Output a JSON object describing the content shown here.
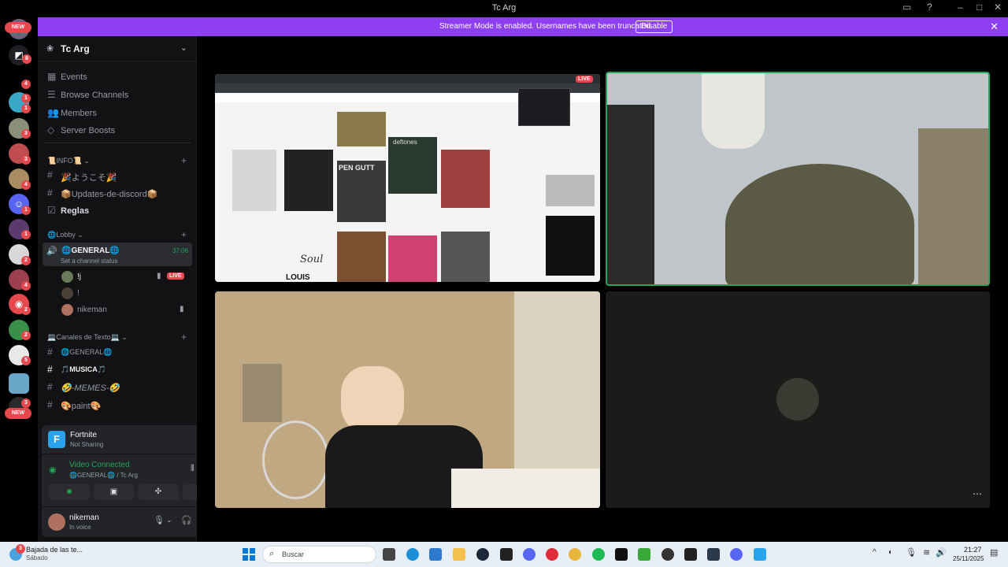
{
  "window": {
    "title": "Tc Arg"
  },
  "banner": {
    "message": "Streamer Mode is enabled. Usernames have been truncated.",
    "disable_label": "Disable"
  },
  "rail": {
    "new_top": "NEW",
    "new_bottom": "NEW",
    "badges": [
      "8",
      "4",
      "1",
      "1",
      "3",
      "3",
      "4",
      "1",
      "1",
      "2",
      "4",
      "2",
      "2",
      "5",
      "3"
    ]
  },
  "guild": {
    "name": "Tc Arg"
  },
  "nav": {
    "events": "Events",
    "browse": "Browse Channels",
    "members": "Members",
    "boosts": "Server Boosts"
  },
  "categories": {
    "info": "📜INFO📜",
    "lobby": "🌐Lobby",
    "text": "💻Canales de Texto💻"
  },
  "info_channels": [
    "🎉ようこそ🎉",
    "📦Updates-de-discord📦",
    "Reglas"
  ],
  "voice": {
    "name": "🌐GENERAL🌐",
    "timer": "37:06",
    "status": "Set a channel status",
    "users": [
      {
        "name": "!j",
        "live": "LIVE"
      },
      {
        "name": "!"
      },
      {
        "name": "nikeman"
      }
    ]
  },
  "text_channels": [
    "🌐GENERAL🌐",
    "🎵MUSICA🎵",
    "🤣-MEMES-🤣",
    "🎨paint🎨"
  ],
  "activity": {
    "game": "Fortnite",
    "status": "Not Sharing"
  },
  "connection": {
    "status": "Video Connected",
    "location": "🌐GENERAL🌐 / Tc Arg"
  },
  "user": {
    "name": "nikeman",
    "status": "In voice"
  },
  "stream": {
    "live": "LIVE"
  },
  "stream_text": {
    "band_logo": "deftones",
    "headline": "PEN GUTT",
    "script": "Soul",
    "logo": "LOUIS"
  },
  "taskbar": {
    "news_title": "Bajada de las te...",
    "news_sub": "Sábado",
    "news_badge": "3",
    "search": "Buscar",
    "time": "21:27",
    "date": "25/11/2025"
  },
  "colors": {
    "accent": "#8d3ff1",
    "live": "#e5484d",
    "connected": "#23a55a"
  }
}
